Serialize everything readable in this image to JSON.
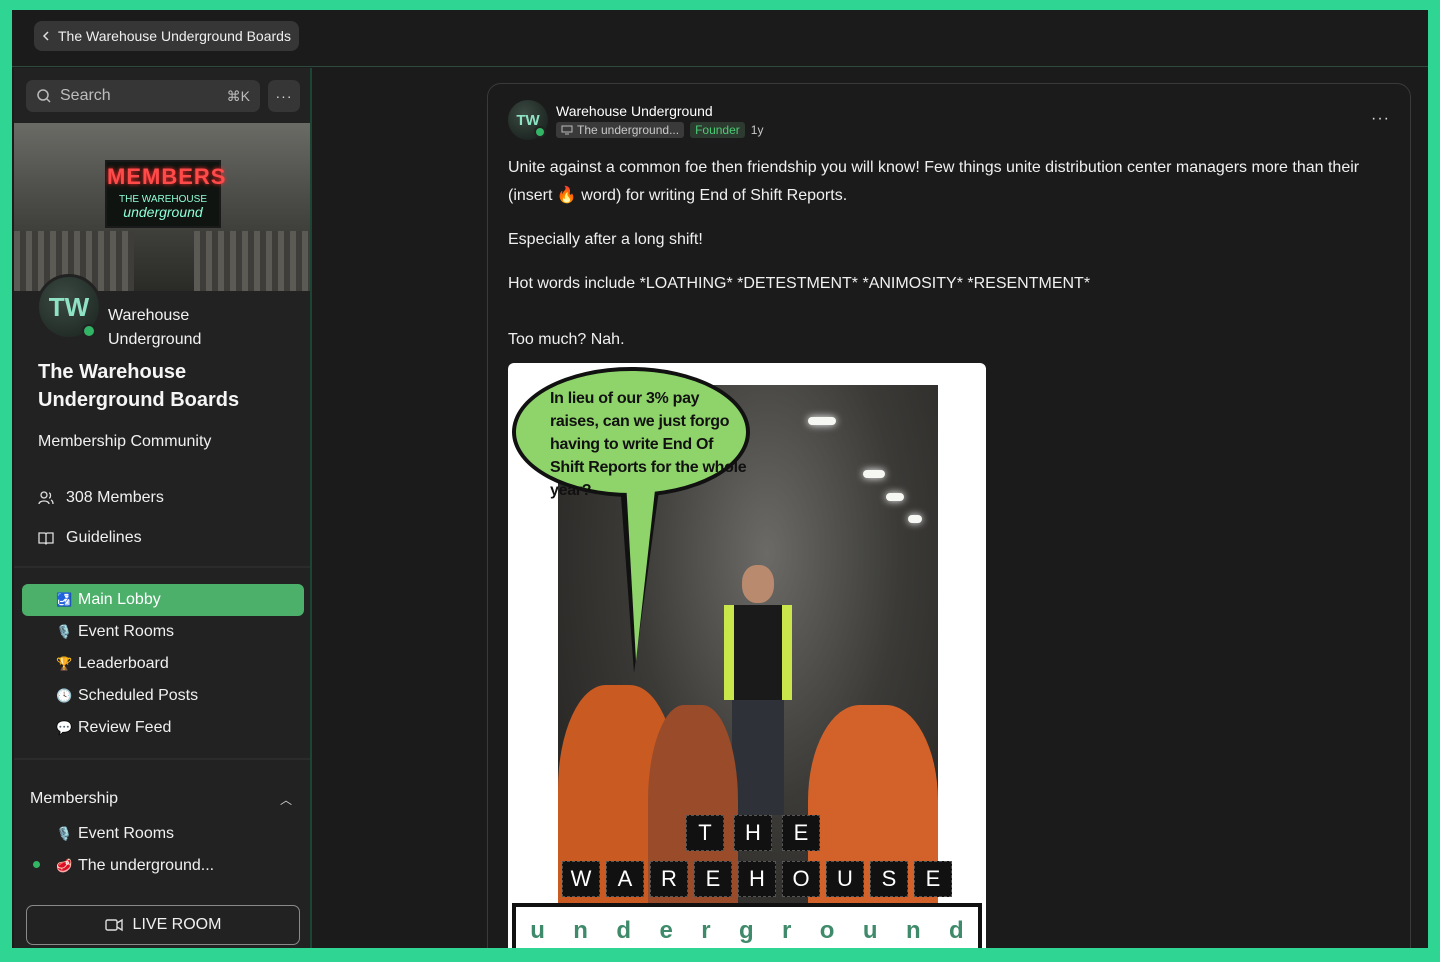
{
  "topbar": {
    "back_label": "The Warehouse Underground Boards"
  },
  "sidebar": {
    "search_placeholder": "Search",
    "search_shortcut": "⌘K",
    "more_label": "···",
    "banner": {
      "sign_main": "MEMBERS",
      "sign_line1": "THE WAREHOUSE",
      "sign_line2": "underground"
    },
    "owner_name": "Warehouse Underground",
    "group_title": "The Warehouse Underground Boards",
    "group_subtitle": "Membership Community",
    "members_count": "308 Members",
    "guidelines": "Guidelines",
    "nav": [
      {
        "label": "Main Lobby",
        "icon": "🛃",
        "active": true
      },
      {
        "label": "Event Rooms",
        "icon": "🎙️"
      },
      {
        "label": "Leaderboard",
        "icon": "🏆"
      },
      {
        "label": "Scheduled Posts",
        "icon": "🕓"
      },
      {
        "label": "Review Feed",
        "icon": "💬"
      }
    ],
    "membership_section": {
      "title": "Membership",
      "items": [
        {
          "label": "Event Rooms",
          "icon": "🎙️"
        },
        {
          "label": "The underground...",
          "icon": "🥩",
          "unread": true
        }
      ]
    },
    "live_room_label": "LIVE ROOM"
  },
  "post": {
    "author": "Warehouse Underground",
    "room": "The underground...",
    "badge": "Founder",
    "age": "1y",
    "menu_label": "···",
    "p1": "Unite against a common foe then friendship you will know! Few things unite distribution center managers more than their (insert 🔥 word) for writing End of Shift Reports.",
    "p2": "Especially after a long shift!",
    "p3": "Hot words include *LOATHING* *DETESTMENT* *ANIMOSITY* *RESENTMENT*",
    "p4": "Too much? Nah.",
    "meme": {
      "bubble": "In lieu of our 3% pay raises, can we just forgo having to write End Of Shift Reports for the whole year?",
      "logo_row1": [
        "T",
        "H",
        "E"
      ],
      "logo_row2": [
        "W",
        "A",
        "R",
        "E",
        "H",
        "O",
        "U",
        "S",
        "E"
      ],
      "logo_row3": [
        "u",
        "n",
        "d",
        "e",
        "r",
        "g",
        "r",
        "o",
        "u",
        "n",
        "d"
      ]
    }
  },
  "colors": {
    "accent": "#4caf6a",
    "frame": "#2fd693",
    "background": "#1b1b1b"
  }
}
